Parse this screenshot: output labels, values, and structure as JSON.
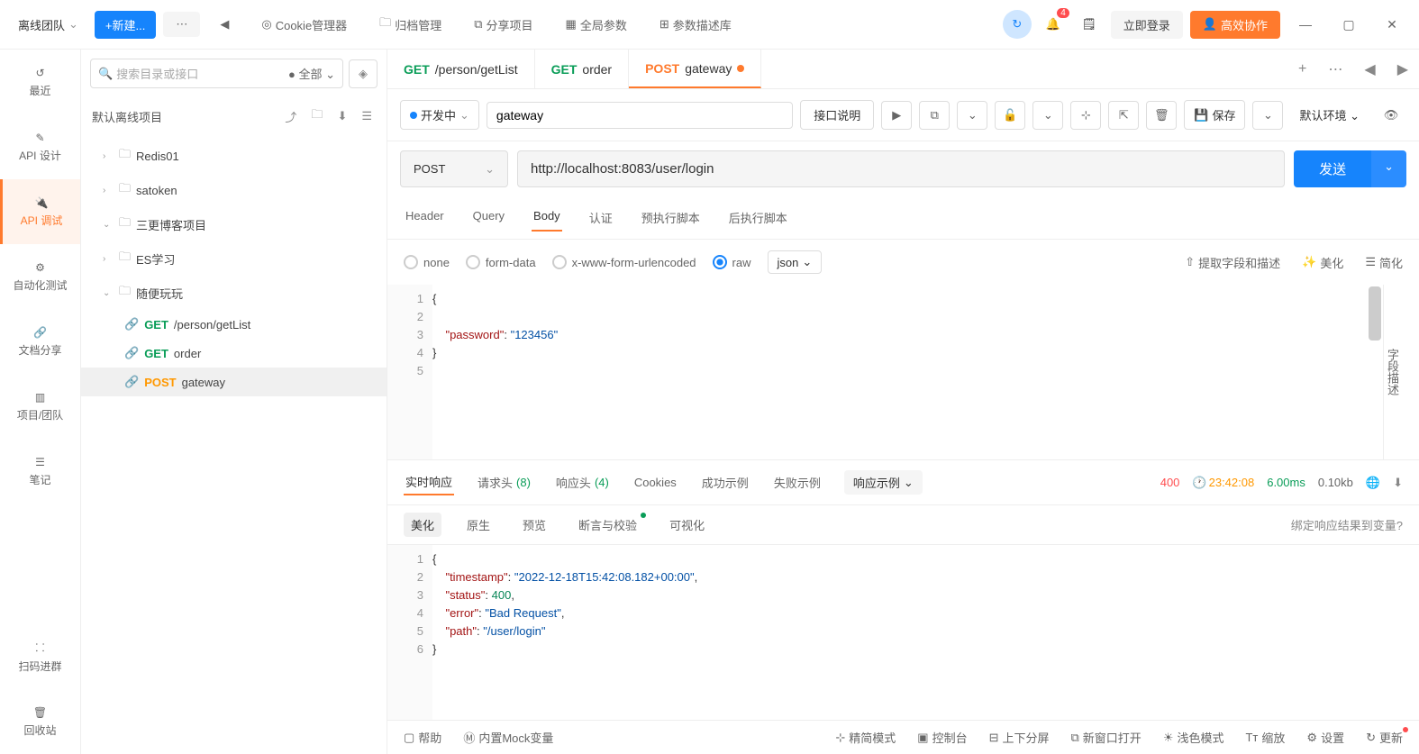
{
  "topbar": {
    "team": "离线团队",
    "new_btn": "+新建...",
    "nav": {
      "cookie": "Cookie管理器",
      "archive": "归档管理",
      "share": "分享项目",
      "global": "全局参数",
      "paramlib": "参数描述库"
    },
    "notif_count": "4",
    "login": "立即登录",
    "collab": "高效协作"
  },
  "leftnav": {
    "recent": "最近",
    "design": "API 设计",
    "debug": "API 调试",
    "auto": "自动化测试",
    "share": "文档分享",
    "project": "项目/团队",
    "note": "笔记",
    "scan": "扫码进群",
    "trash": "回收站"
  },
  "tree": {
    "search_placeholder": "搜索目录或接口",
    "filter": "全部",
    "project": "默认离线项目",
    "nodes": [
      {
        "label": "Redis01",
        "type": "folder",
        "open": false
      },
      {
        "label": "satoken",
        "type": "folder",
        "open": false
      },
      {
        "label": "三更博客项目",
        "type": "folder",
        "open": true
      },
      {
        "label": "ES学习",
        "type": "folder",
        "open": false
      },
      {
        "label": "随便玩玩",
        "type": "folder",
        "open": true
      }
    ],
    "apis": [
      {
        "method": "GET",
        "name": "/person/getList"
      },
      {
        "method": "GET",
        "name": "order"
      },
      {
        "method": "POST",
        "name": "gateway",
        "selected": true
      }
    ]
  },
  "tabs": [
    {
      "method": "GET",
      "name": "/person/getList",
      "active": false
    },
    {
      "method": "GET",
      "name": "order",
      "active": false
    },
    {
      "method": "POST",
      "name": "gateway",
      "active": true,
      "dirty": true
    }
  ],
  "reqbar": {
    "status": "开发中",
    "title": "gateway",
    "desc_btn": "接口说明",
    "save": "保存",
    "env": "默认环境"
  },
  "request": {
    "method": "POST",
    "url": "http://localhost:8083/user/login",
    "send": "发送"
  },
  "req_tabs": [
    "Header",
    "Query",
    "Body",
    "认证",
    "预执行脚本",
    "后执行脚本"
  ],
  "body_opts": {
    "none": "none",
    "formdata": "form-data",
    "urlenc": "x-www-form-urlencoded",
    "raw": "raw",
    "type": "json"
  },
  "body_actions": {
    "extract": "提取字段和描述",
    "beautify": "美化",
    "compact": "简化"
  },
  "side_label": "字段描述",
  "body_lines": [
    "{",
    "",
    "    \"password\": \"123456\"",
    "}",
    ""
  ],
  "resp_tabs": {
    "realtime": "实时响应",
    "req_headers": "请求头",
    "req_headers_count": "(8)",
    "resp_headers": "响应头",
    "resp_headers_count": "(4)",
    "cookies": "Cookies",
    "success": "成功示例",
    "fail": "失败示例",
    "example": "响应示例"
  },
  "resp_meta": {
    "status": "400",
    "time": "23:42:08",
    "duration": "6.00ms",
    "size": "0.10kb"
  },
  "view_tabs": {
    "beautify": "美化",
    "raw": "原生",
    "preview": "预览",
    "assert": "断言与校验",
    "visual": "可视化",
    "bind": "绑定响应结果到变量?"
  },
  "response": {
    "timestamp": "2022-12-18T15:42:08.182+00:00",
    "status": 400,
    "error": "Bad Request",
    "path": "/user/login"
  },
  "footer": {
    "help": "帮助",
    "mock": "内置Mock变量",
    "compact": "精简模式",
    "console": "控制台",
    "split": "上下分屏",
    "newwin": "新窗口打开",
    "light": "浅色模式",
    "zoom": "缩放",
    "settings": "设置",
    "update": "更新"
  }
}
